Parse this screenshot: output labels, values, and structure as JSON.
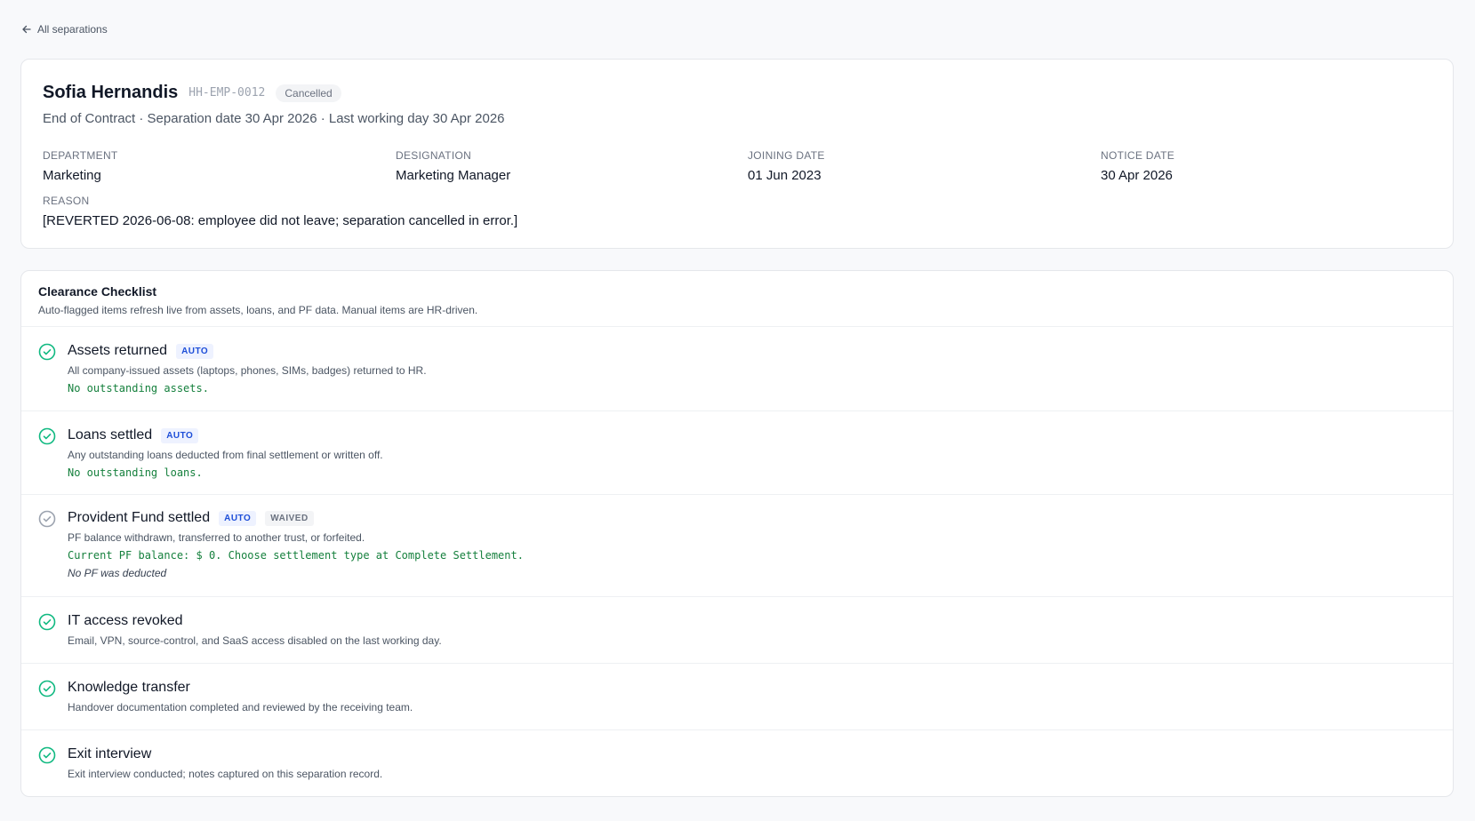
{
  "nav": {
    "back_label": "All separations"
  },
  "employee": {
    "name": "Sofia Hernandis",
    "code": "HH-EMP-0012",
    "status": "Cancelled",
    "summary": "End of Contract · Separation date 30 Apr 2026 · Last working day 30 Apr 2026"
  },
  "fields": {
    "department": {
      "label": "DEPARTMENT",
      "value": "Marketing"
    },
    "designation": {
      "label": "DESIGNATION",
      "value": "Marketing Manager"
    },
    "joining_date": {
      "label": "JOINING DATE",
      "value": "01 Jun 2023"
    },
    "notice_date": {
      "label": "NOTICE DATE",
      "value": "30 Apr 2026"
    },
    "reason": {
      "label": "REASON",
      "value": "[REVERTED 2026-06-08: employee did not leave; separation cancelled in error.]"
    }
  },
  "checklist": {
    "title": "Clearance Checklist",
    "subtitle": "Auto-flagged items refresh live from assets, loans, and PF data. Manual items are HR-driven.",
    "tag_auto": "AUTO",
    "tag_waived": "WAIVED",
    "items": [
      {
        "title": "Assets returned",
        "desc": "All company-issued assets (laptops, phones, SIMs, badges) returned to HR.",
        "note": "No outstanding assets.",
        "status": "done"
      },
      {
        "title": "Loans settled",
        "desc": "Any outstanding loans deducted from final settlement or written off.",
        "note": "No outstanding loans.",
        "status": "done"
      },
      {
        "title": "Provident Fund settled",
        "desc": "PF balance withdrawn, transferred to another trust, or forfeited.",
        "note": "Current PF balance: $ 0. Choose settlement type at Complete Settlement.",
        "remark": "No PF was deducted",
        "status": "waived"
      },
      {
        "title": "IT access revoked",
        "desc": "Email, VPN, source-control, and SaaS access disabled on the last working day.",
        "status": "done"
      },
      {
        "title": "Knowledge transfer",
        "desc": "Handover documentation completed and reviewed by the receiving team.",
        "status": "done"
      },
      {
        "title": "Exit interview",
        "desc": "Exit interview conducted; notes captured on this separation record.",
        "status": "done"
      }
    ]
  },
  "colors": {
    "done": "#10b981",
    "waived": "#9ca3af",
    "auto_tag": "#1d4ed8",
    "note": "#15803d"
  },
  "icons": {
    "back": "arrow-left-icon",
    "done": "check-circle-icon",
    "waived": "check-circle-muted-icon"
  }
}
